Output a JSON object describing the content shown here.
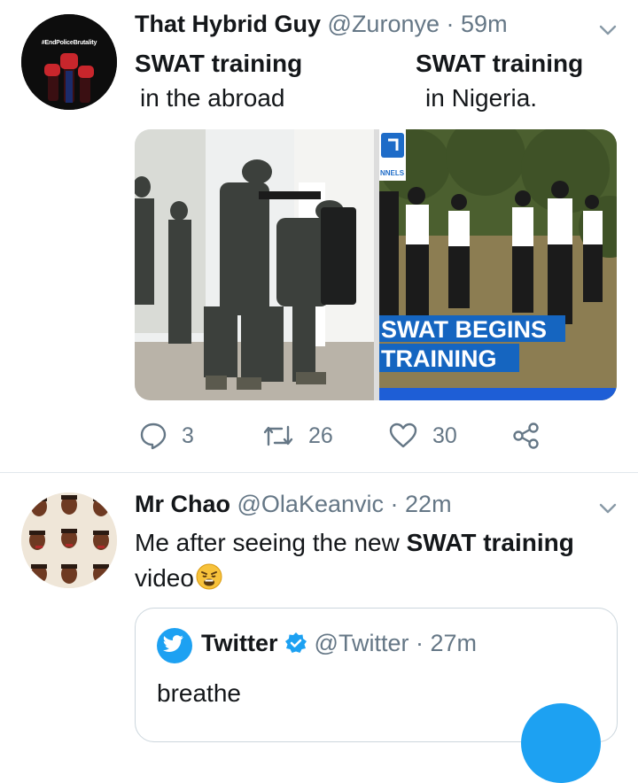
{
  "tweets": [
    {
      "author_name": "That Hybrid Guy",
      "handle": "@Zuronye",
      "separator": "·",
      "time": "59m",
      "avatar_text": "#EndPoliceBrutality",
      "text_left_line1": "SWAT training",
      "text_left_line2": "in the abroad",
      "text_right_line1": "SWAT training",
      "text_right_line2": "in Nigeria.",
      "media_right_logo": "NNELS",
      "media_right_caption_line1": "SWAT BEGINS",
      "media_right_caption_line2": "TRAINING",
      "actions": {
        "replies": "3",
        "retweets": "26",
        "likes": "30"
      }
    },
    {
      "author_name": "Mr Chao",
      "handle": "@OlaKeanvic",
      "separator": "·",
      "time": "22m",
      "text_part1": "Me after seeing the new ",
      "text_bold": "SWAT training",
      "text_part2": "video",
      "emoji": "😩",
      "quote": {
        "author_name": "Twitter",
        "handle": "@Twitter",
        "separator": "·",
        "time": "27m",
        "text": "breathe"
      }
    }
  ],
  "colors": {
    "accent": "#1da1f2",
    "muted": "#657786",
    "text": "#14171a",
    "border": "#e1e8ed"
  }
}
